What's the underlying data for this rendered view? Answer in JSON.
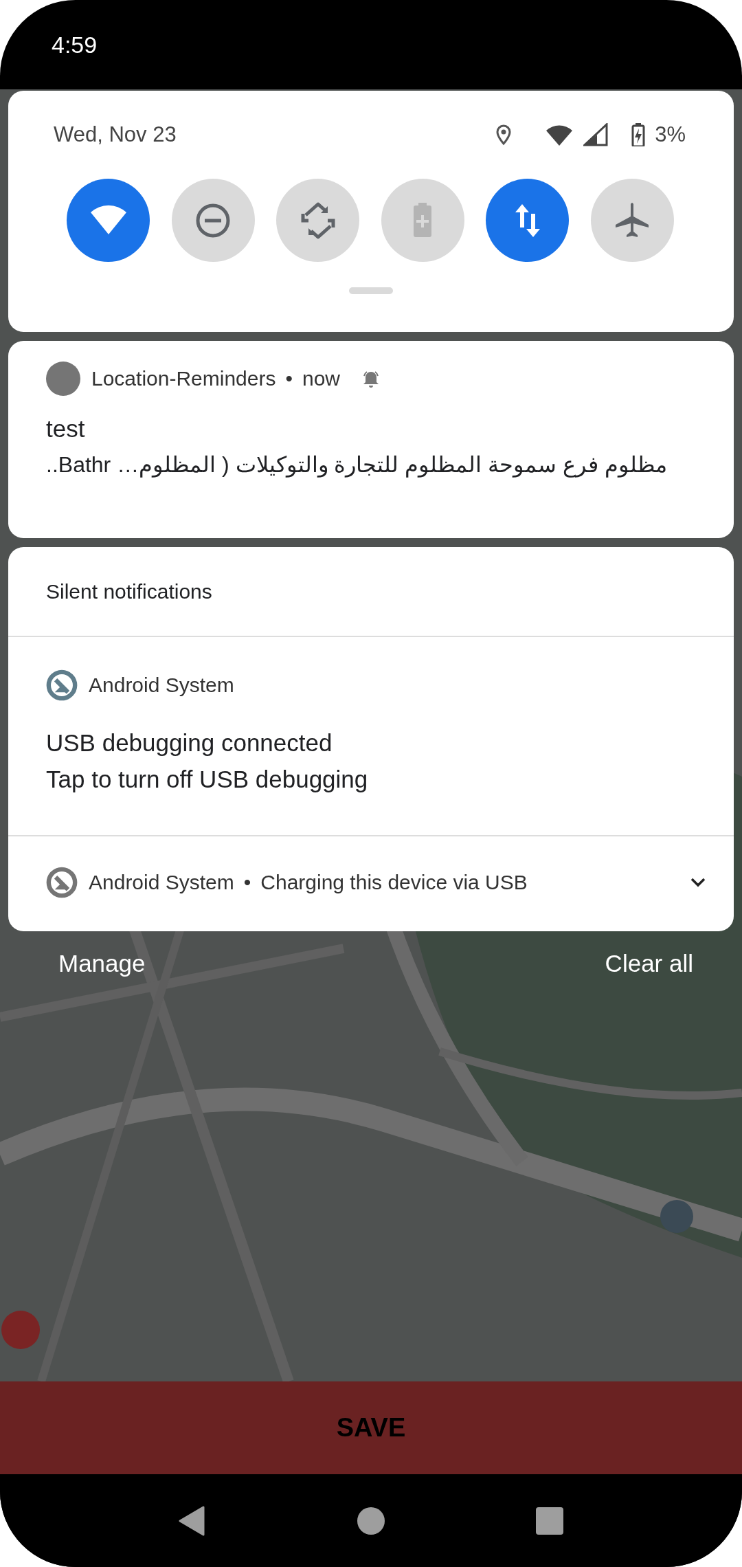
{
  "status_bar": {
    "time": "4:59"
  },
  "quick_settings": {
    "date": "Wed, Nov 23",
    "battery": "3%",
    "tiles": [
      {
        "kind": "wifi",
        "on": true,
        "disabled": false
      },
      {
        "kind": "dnd",
        "on": false,
        "disabled": false
      },
      {
        "kind": "rotate",
        "on": false,
        "disabled": false
      },
      {
        "kind": "battery",
        "on": false,
        "disabled": true
      },
      {
        "kind": "data",
        "on": true,
        "disabled": false
      },
      {
        "kind": "airplane",
        "on": false,
        "disabled": false
      }
    ]
  },
  "notification": {
    "app": "Location-Reminders",
    "separator": "•",
    "time": "now",
    "title": "test",
    "text": "مظلوم فرع سموحة المظلوم للتجارة والتوكيلات ( المظلوم… Bathr.."
  },
  "silent": {
    "header": "Silent notifications",
    "items": [
      {
        "app": "Android System",
        "expanded": true,
        "title": "USB debugging connected",
        "text": "Tap to turn off USB debugging"
      },
      {
        "app": "Android System",
        "expanded": false,
        "separator": "•",
        "summary": "Charging this device via USB"
      }
    ]
  },
  "actions": {
    "manage": "Manage",
    "clear": "Clear all"
  },
  "app": {
    "save": "SAVE"
  }
}
